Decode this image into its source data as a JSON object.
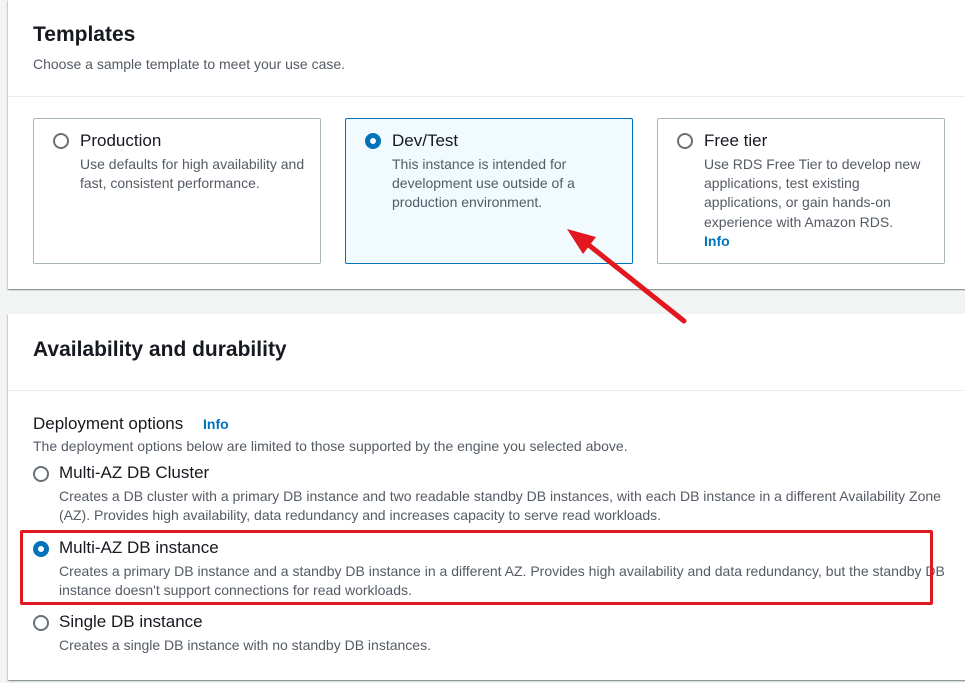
{
  "templates": {
    "title": "Templates",
    "description": "Choose a sample template to meet your use case.",
    "options": [
      {
        "label": "Production",
        "description": "Use defaults for high availability and fast, consistent performance.",
        "selected": false
      },
      {
        "label": "Dev/Test",
        "description": "This instance is intended for development use outside of a production environment.",
        "selected": true
      },
      {
        "label": "Free tier",
        "description": "Use RDS Free Tier to develop new applications, test existing applications, or gain hands-on experience with Amazon RDS.",
        "info": "Info",
        "selected": false
      }
    ]
  },
  "availability": {
    "title": "Availability and durability",
    "deployment_label": "Deployment options",
    "info": "Info",
    "deployment_description": "The deployment options below are limited to those supported by the engine you selected above.",
    "options": [
      {
        "label": "Multi-AZ DB Cluster",
        "description": "Creates a DB cluster with a primary DB instance and two readable standby DB instances, with each DB instance in a different Availability Zone (AZ). Provides high availability, data redundancy and increases capacity to serve read workloads.",
        "selected": false
      },
      {
        "label": "Multi-AZ DB instance",
        "description": "Creates a primary DB instance and a standby DB instance in a different AZ. Provides high availability and data redundancy, but the standby DB instance doesn't support connections for read workloads.",
        "selected": true
      },
      {
        "label": "Single DB instance",
        "description": "Creates a single DB instance with no standby DB instances.",
        "selected": false
      }
    ]
  },
  "colors": {
    "accent": "#0073bb",
    "annotation": "#e3171f",
    "selected_tile_bg": "#f1faff"
  }
}
